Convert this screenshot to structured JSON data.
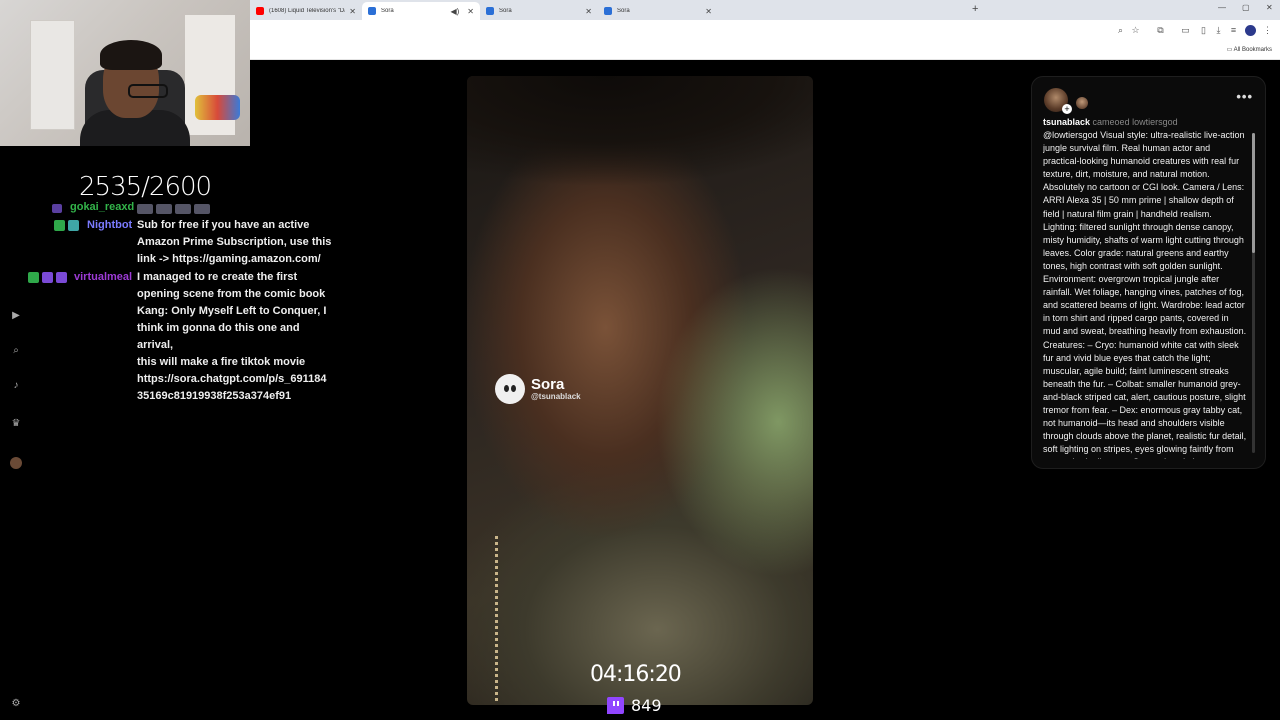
{
  "browser": {
    "tabs": [
      {
        "title": "(1608) Liquid Television's \"Darkt",
        "favicon_color": "#ff0000"
      },
      {
        "title": "Sora",
        "favicon_color": "#2b6fd6"
      },
      {
        "title": "Sora",
        "favicon_color": "#2b6fd6"
      },
      {
        "title": "Sora",
        "favicon_color": "#2b6fd6"
      }
    ],
    "all_bookmarks_label": "All Bookmarks"
  },
  "stream": {
    "counter": "2535/2600",
    "timer": "04:16:20",
    "viewers": "849"
  },
  "chat": {
    "messages": [
      {
        "user": "gokai_reaxd",
        "user_color": "#33b44a",
        "text": ""
      },
      {
        "user": "Nightbot",
        "user_color": "#7b7bff",
        "text_lines": [
          "Sub for free if you have an active",
          "Amazon Prime Subscription, use this",
          "link -> https://gaming.amazon.com/"
        ]
      },
      {
        "user": "virtualmeal",
        "user_color": "#9d3bd6",
        "text_lines": [
          "I managed to re create the first",
          "opening scene from the comic book",
          "Kang: Only Myself Left to Conquer, I",
          "think im gonna do this one and arrival,",
          "this will make a fire tiktok movie",
          "https://sora.chatgpt.com/p/s_691184",
          "35169c81919938f253a374ef91"
        ]
      }
    ]
  },
  "video": {
    "watermark_name": "Sora",
    "watermark_handle": "@tsunablack"
  },
  "post": {
    "username": "tsunablack",
    "cameo_text": "cameoed lowtiersgod",
    "description": "@lowtiersgod Visual style: ultra-realistic live-action jungle survival film. Real human actor and practical-looking humanoid creatures with real fur texture, dirt, moisture, and natural motion. Absolutely no cartoon or CGI look. Camera / Lens: ARRI Alexa 35 | 50 mm prime | shallow depth of field | natural film grain | handheld realism. Lighting: filtered sunlight through dense canopy, misty humidity, shafts of warm light cutting through leaves. Color grade: natural greens and earthy tones, high contrast with soft golden sunlight. Environment: overgrown tropical jungle after rainfall. Wet foliage, hanging vines, patches of fog, and scattered beams of light. Wardrobe: lead actor in torn shirt and ripped cargo pants, covered in mud and sweat, breathing heavily from exhaustion. Creatures: – Cryo: humanoid white cat with sleek fur and vivid blue eyes that catch the light; muscular, agile build; faint luminescent streaks beneath the fur. – Colbat: smaller humanoid grey-and-black striped cat, alert, cautious posture, slight tremor from fear. – Dex: enormous gray tabby cat, not humanoid—its head and shoulders visible through clouds above the planet, realistic fur detail, soft lighting on stripes, eyes glowing faintly from atmospheric distance. Scene description: [CAMERA:"
  }
}
